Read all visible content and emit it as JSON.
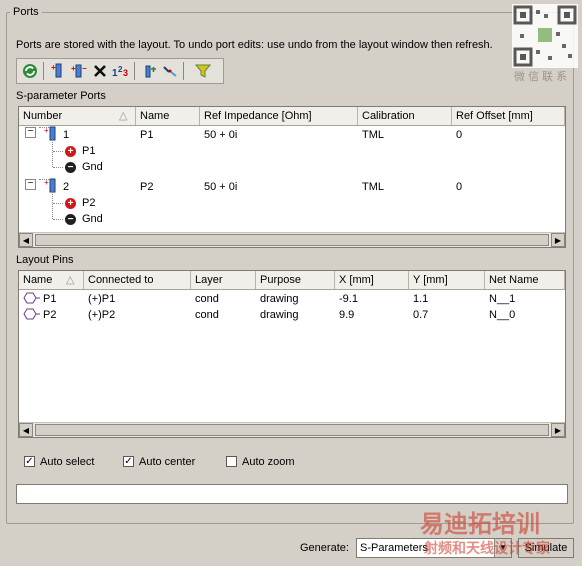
{
  "group": {
    "title": "Ports"
  },
  "info_text": "Ports are stored with the layout. To undo port edits: use undo from the layout window then refresh.",
  "toolbar": {
    "icons": [
      "refresh-icon",
      "add-port-icon",
      "add-pin-port-icon",
      "delete-icon",
      "renumber-icon",
      "add-ground-icon",
      "unassign-icon",
      "filter-icon"
    ]
  },
  "sparam": {
    "label": "S-parameter Ports",
    "columns": [
      "Number",
      "Name",
      "Ref Impedance [Ohm]",
      "Calibration",
      "Ref Offset [mm]"
    ],
    "ports": [
      {
        "number": "1",
        "name": "P1",
        "impedance": "50 + 0i",
        "calibration": "TML",
        "offset": "0",
        "plus": "P1",
        "minus": "Gnd"
      },
      {
        "number": "2",
        "name": "P2",
        "impedance": "50 + 0i",
        "calibration": "TML",
        "offset": "0",
        "plus": "P2",
        "minus": "Gnd"
      }
    ]
  },
  "pins": {
    "label": "Layout Pins",
    "columns": [
      "Name",
      "Connected to",
      "Layer",
      "Purpose",
      "X [mm]",
      "Y [mm]",
      "Net Name"
    ],
    "rows": [
      {
        "name": "P1",
        "connected": "(+)P1",
        "layer": "cond",
        "purpose": "drawing",
        "x": "-9.1",
        "y": "1.1",
        "net": "N__1"
      },
      {
        "name": "P2",
        "connected": "(+)P2",
        "layer": "cond",
        "purpose": "drawing",
        "x": "9.9",
        "y": "0.7",
        "net": "N__0"
      }
    ]
  },
  "options": {
    "auto_select": {
      "label": "Auto select",
      "checked": true
    },
    "auto_center": {
      "label": "Auto center",
      "checked": true
    },
    "auto_zoom": {
      "label": "Auto zoom",
      "checked": false
    }
  },
  "footer": {
    "generate_label": "Generate:",
    "generate_value": "S-Parameters",
    "simulate_label": "Simulate"
  },
  "watermark": {
    "qr_caption": "微信联系",
    "brand": "易迪拓培训",
    "sub": "射频和天线设计专家"
  }
}
